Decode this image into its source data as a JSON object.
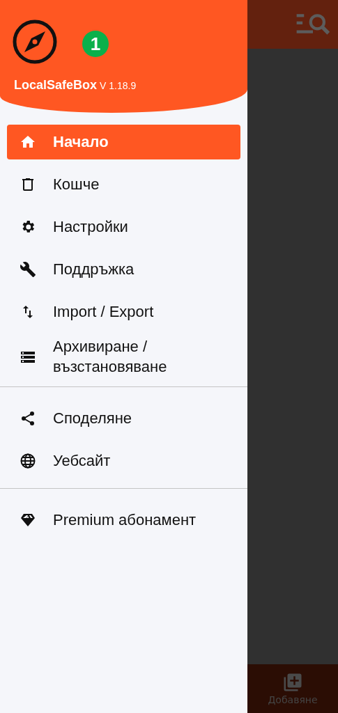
{
  "drawer": {
    "app_name": "LocalSafeBox",
    "version": "V 1.18.9",
    "badge": "1",
    "sections": [
      [
        {
          "label": "Начало",
          "kind": "home",
          "selected": true
        },
        {
          "label": "Кошче",
          "kind": "trash",
          "selected": false
        },
        {
          "label": "Настройки",
          "kind": "gear",
          "selected": false
        },
        {
          "label": "Поддръжка",
          "kind": "wrench",
          "selected": false
        },
        {
          "label": "Import / Export",
          "kind": "arrows",
          "selected": false
        },
        {
          "label": "Архивиране / възстановяване",
          "kind": "storage",
          "selected": false
        }
      ],
      [
        {
          "label": "Споделяне",
          "kind": "share",
          "selected": false
        },
        {
          "label": "Уебсайт",
          "kind": "globe",
          "selected": false
        }
      ],
      [
        {
          "label": "Premium абонамент",
          "kind": "diamond",
          "selected": false
        }
      ]
    ]
  },
  "bottom_nav": {
    "label": "Добавяне"
  }
}
